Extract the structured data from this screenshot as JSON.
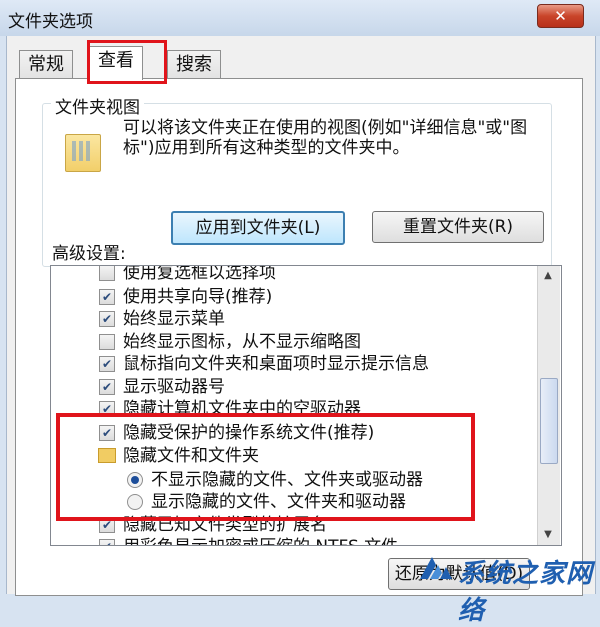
{
  "window": {
    "title": "文件夹选项",
    "close_glyph": "✕"
  },
  "tabs": [
    "常规",
    "查看",
    "搜索"
  ],
  "folder_views": {
    "title": "文件夹视图",
    "description": "可以将该文件夹正在使用的视图(例如\"详细信息\"或\"图标\")应用到所有这种类型的文件夹中。",
    "apply_label": "应用到文件夹(L)",
    "reset_label": "重置文件夹(R)"
  },
  "advanced": {
    "label": "高级设置:",
    "items": [
      {
        "type": "checkbox",
        "checked": false,
        "label": "使用复选框以选择项"
      },
      {
        "type": "checkbox",
        "checked": true,
        "label": "使用共享向导(推荐)"
      },
      {
        "type": "checkbox",
        "checked": true,
        "label": "始终显示菜单"
      },
      {
        "type": "checkbox",
        "checked": false,
        "label": "始终显示图标，从不显示缩略图"
      },
      {
        "type": "checkbox",
        "checked": true,
        "label": "鼠标指向文件夹和桌面项时显示提示信息"
      },
      {
        "type": "checkbox",
        "checked": true,
        "label": "显示驱动器号"
      },
      {
        "type": "checkbox",
        "checked": true,
        "label": "隐藏计算机文件夹中的空驱动器"
      },
      {
        "type": "checkbox",
        "checked": true,
        "label": "隐藏受保护的操作系统文件(推荐)"
      },
      {
        "type": "folder",
        "label": "隐藏文件和文件夹"
      },
      {
        "type": "radio",
        "checked": true,
        "label": "不显示隐藏的文件、文件夹或驱动器"
      },
      {
        "type": "radio",
        "checked": false,
        "label": "显示隐藏的文件、文件夹和驱动器"
      },
      {
        "type": "checkbox",
        "checked": true,
        "label": "隐藏已知文件类型的扩展名"
      },
      {
        "type": "checkbox",
        "checked": true,
        "label": "用彩色显示加密或压缩的 NTFS 文件"
      }
    ]
  },
  "footer": {
    "restore_label": "还原为默认值(D)"
  },
  "watermark": {
    "text": "系统之家网络"
  },
  "colors": {
    "highlight": "#e0141b",
    "accent": "#1f5fb0"
  }
}
